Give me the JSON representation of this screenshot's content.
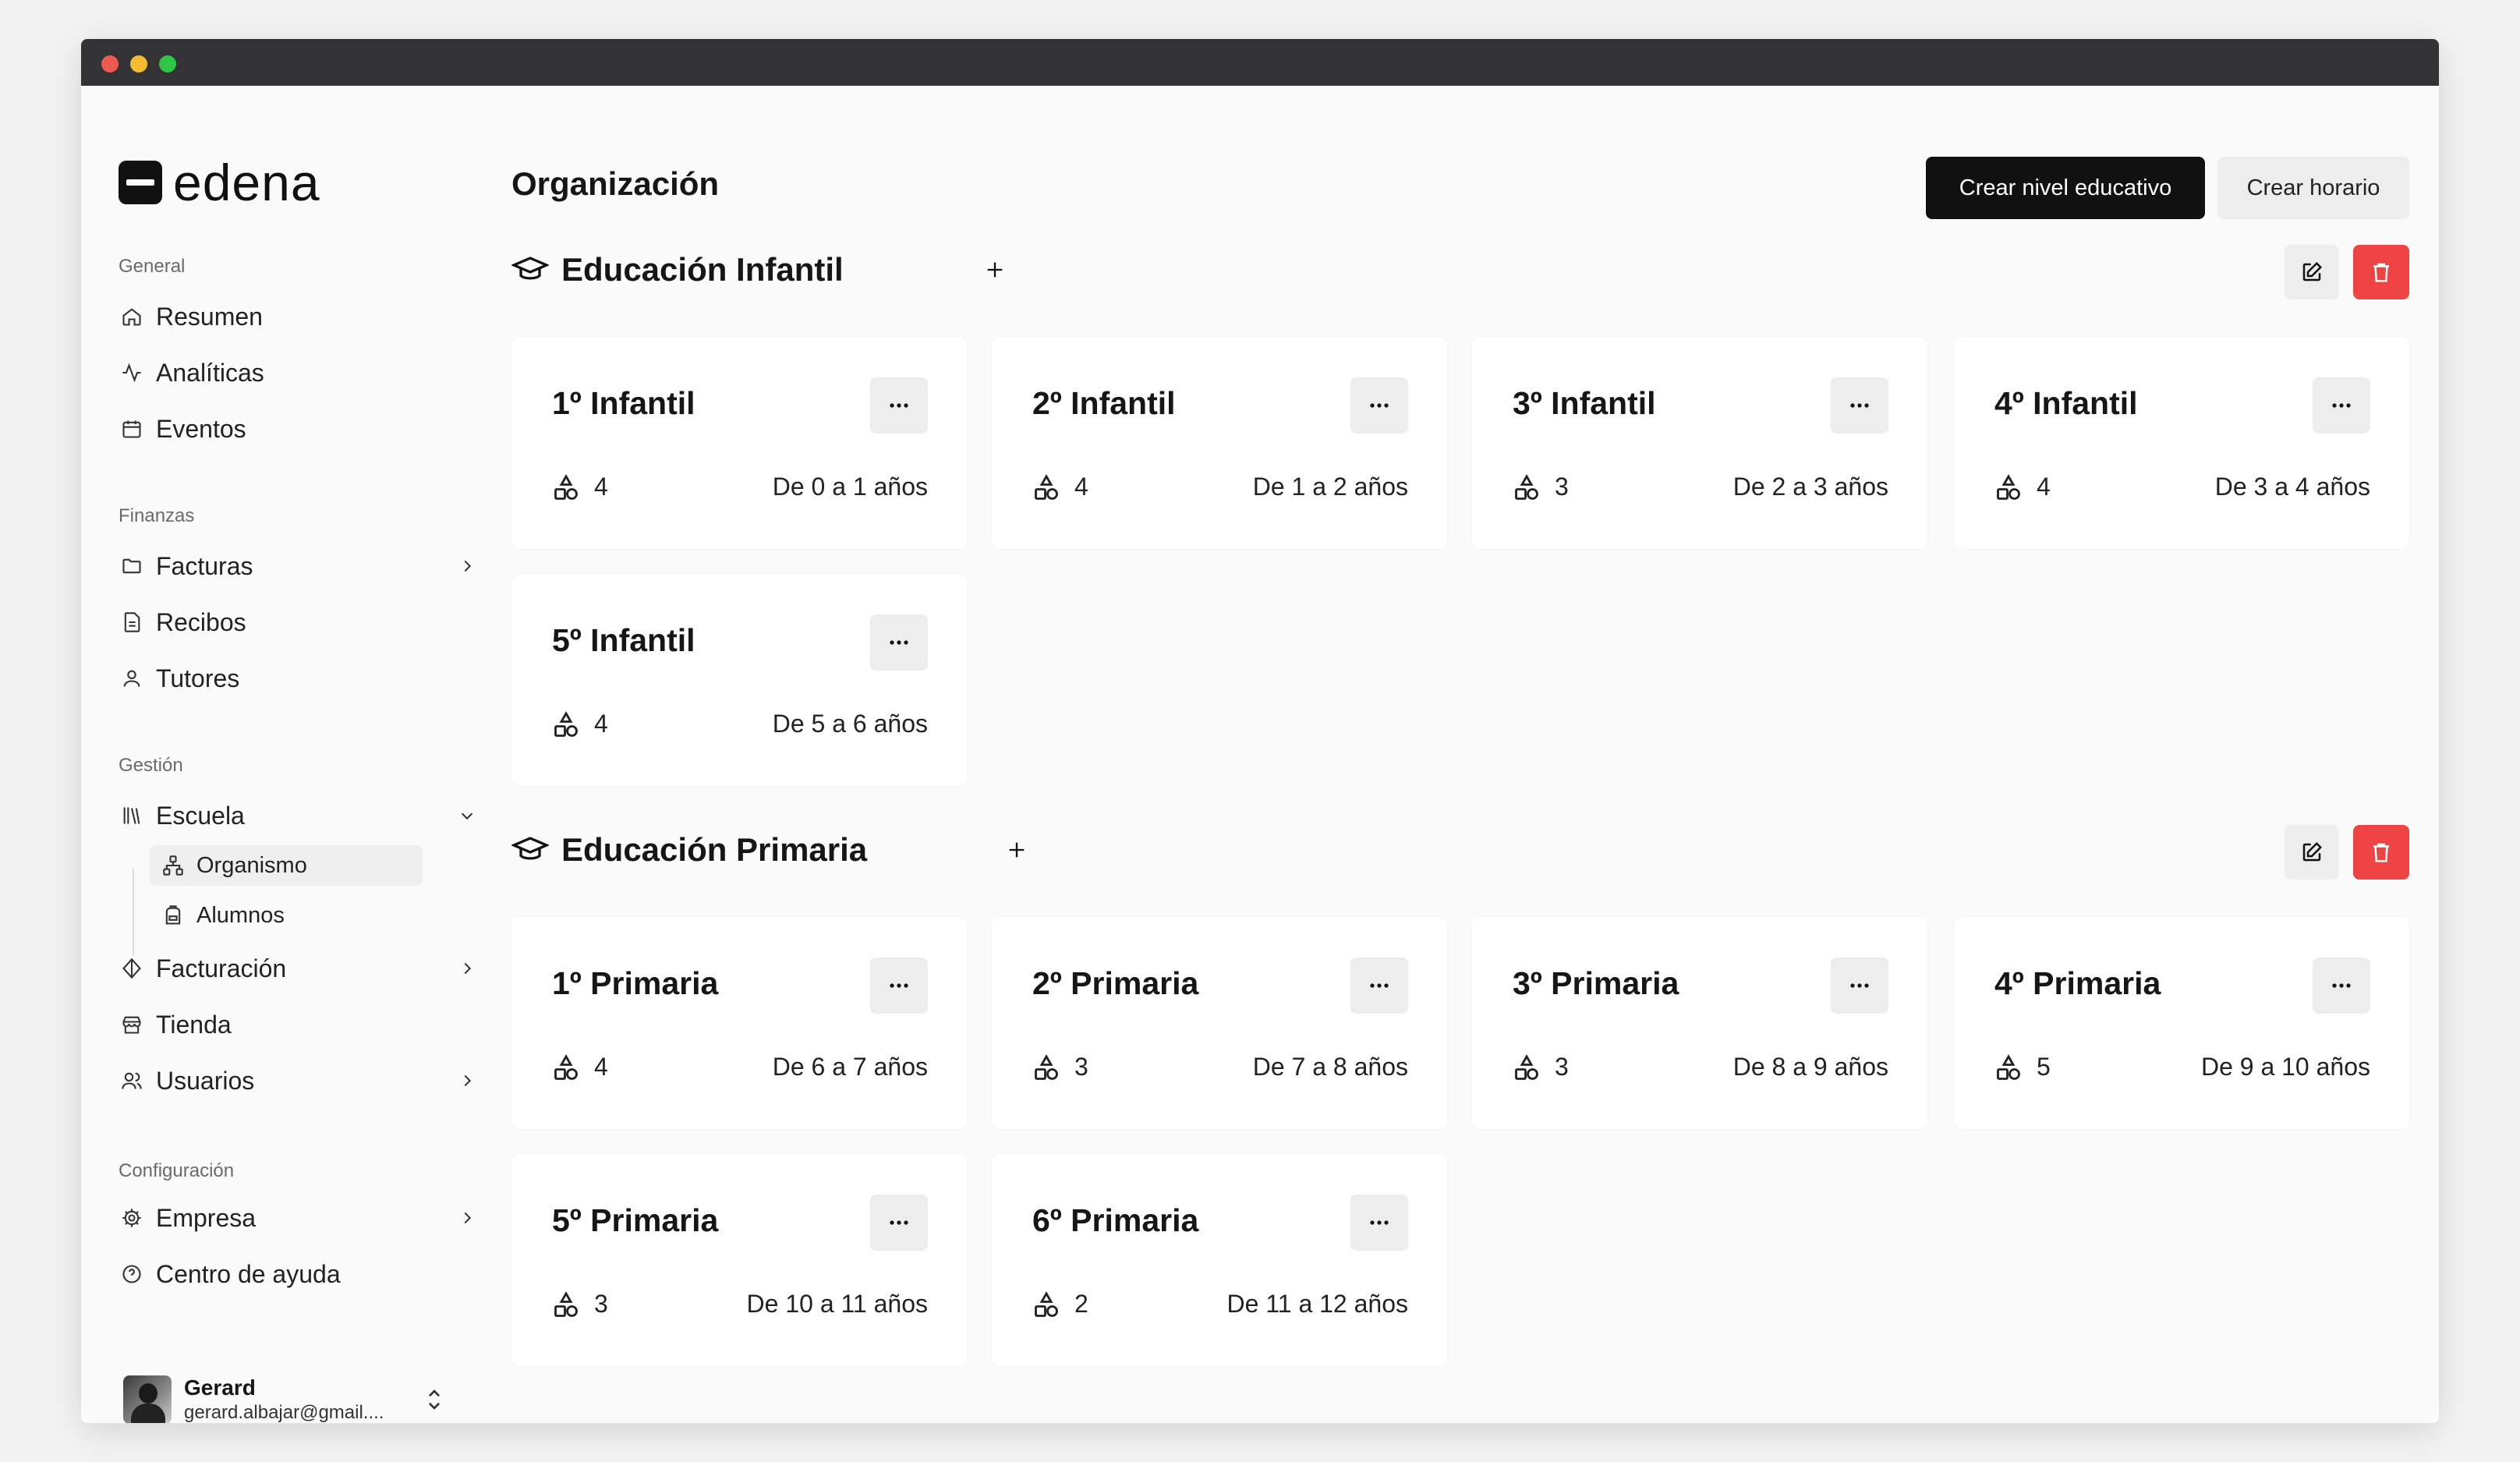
{
  "app": {
    "brand": "edena"
  },
  "sidebar": {
    "groups": [
      {
        "label": "General"
      },
      {
        "label": "Finanzas"
      },
      {
        "label": "Gestión"
      },
      {
        "label": "Configuración"
      }
    ],
    "items": {
      "resumen": "Resumen",
      "analiticas": "Analíticas",
      "eventos": "Eventos",
      "facturas": "Facturas",
      "recibos": "Recibos",
      "tutores": "Tutores",
      "escuela": "Escuela",
      "organismo": "Organismo",
      "alumnos": "Alumnos",
      "facturacion": "Facturación",
      "tienda": "Tienda",
      "usuarios": "Usuarios",
      "empresa": "Empresa",
      "ayuda": "Centro de ayuda"
    },
    "user": {
      "name": "Gerard",
      "email": "gerard.albajar@gmail...."
    }
  },
  "main": {
    "title": "Organización",
    "actions": {
      "primary": "Crear nivel educativo",
      "secondary": "Crear horario"
    },
    "sections": [
      {
        "title": "Educación Infantil",
        "cards": [
          {
            "name": "1º Infantil",
            "count": "4",
            "age": "De 0 a 1 años"
          },
          {
            "name": "2º Infantil",
            "count": "4",
            "age": "De 1 a 2 años"
          },
          {
            "name": "3º Infantil",
            "count": "3",
            "age": "De 2 a 3 años"
          },
          {
            "name": "4º Infantil",
            "count": "4",
            "age": "De 3 a 4 años"
          },
          {
            "name": "5º Infantil",
            "count": "4",
            "age": "De 5 a 6 años"
          }
        ]
      },
      {
        "title": "Educación Primaria",
        "cards": [
          {
            "name": "1º Primaria",
            "count": "4",
            "age": "De 6 a 7 años"
          },
          {
            "name": "2º Primaria",
            "count": "3",
            "age": "De 7 a 8 años"
          },
          {
            "name": "3º Primaria",
            "count": "3",
            "age": "De 8 a 9 años"
          },
          {
            "name": "4º Primaria",
            "count": "5",
            "age": "De 9 a 10 años"
          },
          {
            "name": "5º Primaria",
            "count": "3",
            "age": "De 10 a 11 años"
          },
          {
            "name": "6º Primaria",
            "count": "2",
            "age": "De 11 a 12 años"
          }
        ]
      }
    ]
  },
  "colors": {
    "primary": "#111111",
    "danger": "#ee4444",
    "surface": "#fafafa",
    "card": "#ffffff"
  }
}
